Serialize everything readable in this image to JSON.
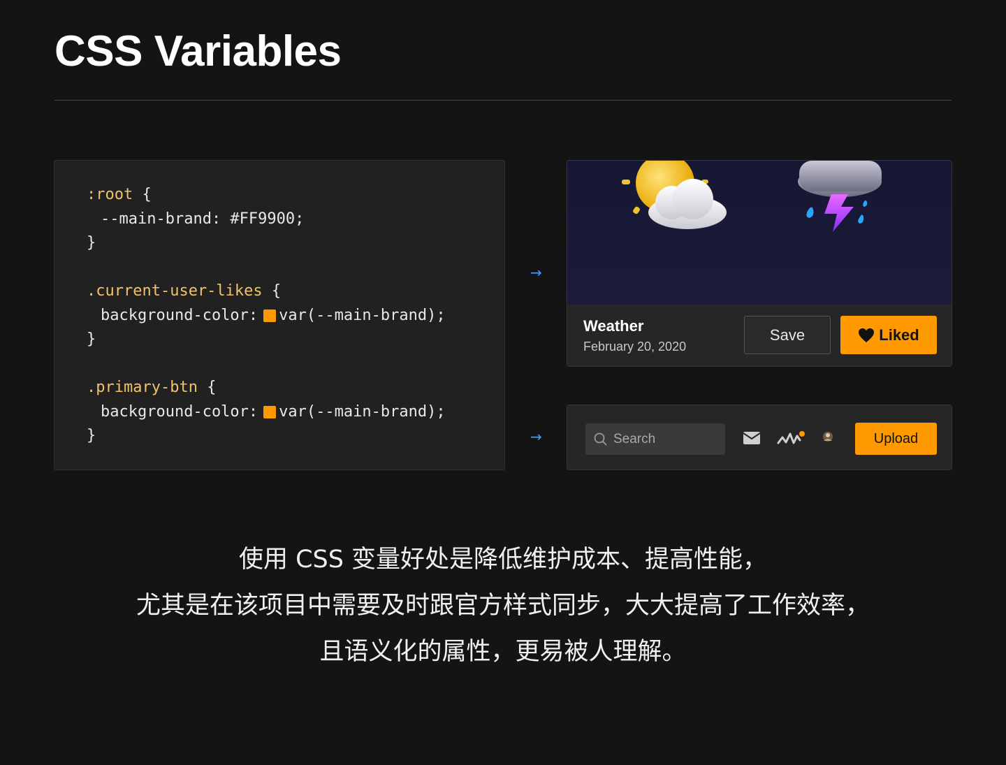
{
  "page": {
    "title": "CSS Variables"
  },
  "code": {
    "lines": [
      {
        "selector": ":root",
        "brace": " {"
      },
      {
        "text": "--main-brand: #FF9900;"
      },
      {
        "text": "}"
      },
      {
        "selector": ".current-user-likes",
        "brace": " {"
      },
      {
        "prop": "background-color:",
        "swatch": "#FF9900",
        "value": "var(--main-brand);"
      },
      {
        "text": "}"
      },
      {
        "selector": ".primary-btn",
        "brace": " {"
      },
      {
        "prop": "background-color:",
        "swatch": "#FF9900",
        "value": "var(--main-brand);"
      },
      {
        "text": "}"
      }
    ]
  },
  "arrows": {
    "glyph": "→"
  },
  "weather_card": {
    "title": "Weather",
    "date": "February 20, 2020",
    "save_label": "Save",
    "liked_label": "Liked",
    "icons": [
      "sun-behind-cloud-icon",
      "storm-cloud-lightning-icon",
      "heart-icon"
    ]
  },
  "toolbar": {
    "search_placeholder": "Search",
    "upload_label": "Upload",
    "icons": [
      "search-icon",
      "mail-icon",
      "activity-icon",
      "avatar-icon"
    ]
  },
  "description": {
    "lines": [
      "使用 CSS 变量好处是降低维护成本、提高性能，",
      "尤其是在该项目中需要及时跟官方样式同步，大大提高了工作效率，",
      "且语义化的属性，更易被人理解。"
    ]
  },
  "colors": {
    "background": "#141414",
    "brand": "#FF9900",
    "selector": "#f0c36a",
    "arrow": "#3d9bff"
  }
}
